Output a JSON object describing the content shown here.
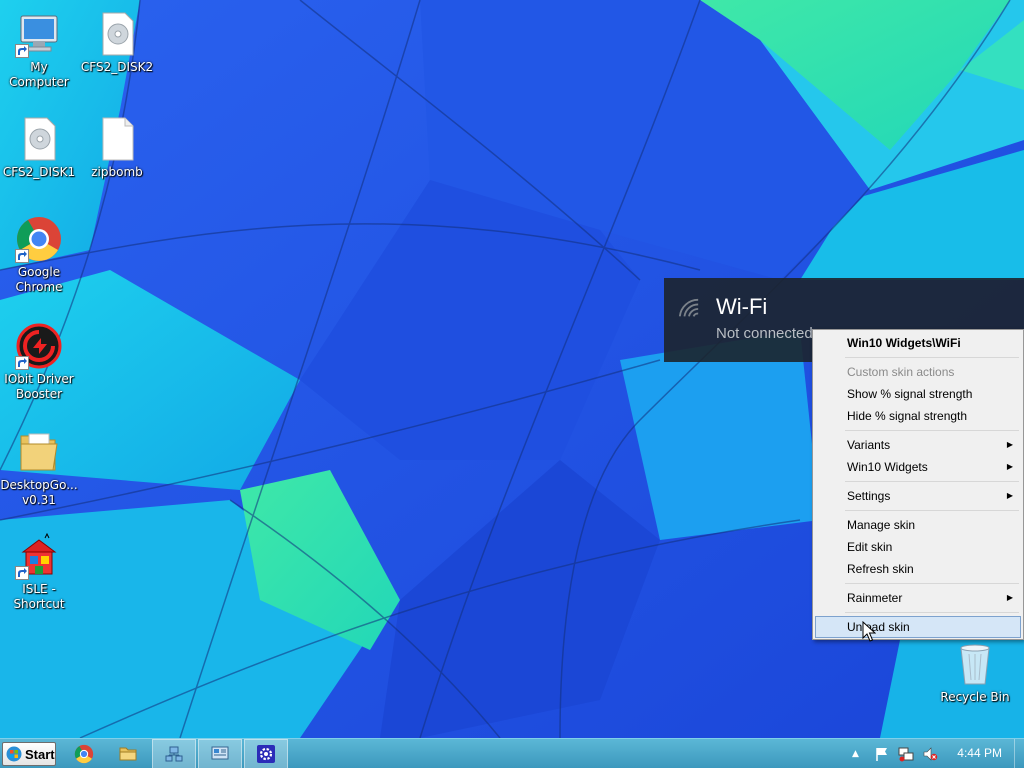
{
  "desktop": {
    "icons": [
      {
        "label": "My Computer"
      },
      {
        "label": "CFS2_DISK2"
      },
      {
        "label": "CFS2_DISK1"
      },
      {
        "label": "zipbomb"
      },
      {
        "label": "Google Chrome"
      },
      {
        "label": "IObit Driver Booster"
      },
      {
        "label": "DesktopGo... v0.31"
      },
      {
        "label": "ISLE - Shortcut"
      },
      {
        "label": "Recycle Bin"
      }
    ]
  },
  "wifi_widget": {
    "title": "Wi-Fi",
    "status": "Not connected"
  },
  "context_menu": {
    "header": "Win10 Widgets\\WiFi",
    "custom_actions_label": "Custom skin actions",
    "show_signal": "Show % signal strength",
    "hide_signal": "Hide % signal strength",
    "variants": "Variants",
    "win10_widgets": "Win10 Widgets",
    "settings": "Settings",
    "manage_skin": "Manage skin",
    "edit_skin": "Edit skin",
    "refresh_skin": "Refresh skin",
    "rainmeter": "Rainmeter",
    "unload_skin": "Unload skin",
    "submenu_glyph": "▶"
  },
  "taskbar": {
    "start_label": "Start",
    "clock": "4:44 PM",
    "tray_expand_glyph": "▲"
  },
  "colors": {
    "menu_highlight": "#d5e6f7",
    "taskbar": "#3c98bd",
    "widget_bg": "#1c242c"
  }
}
